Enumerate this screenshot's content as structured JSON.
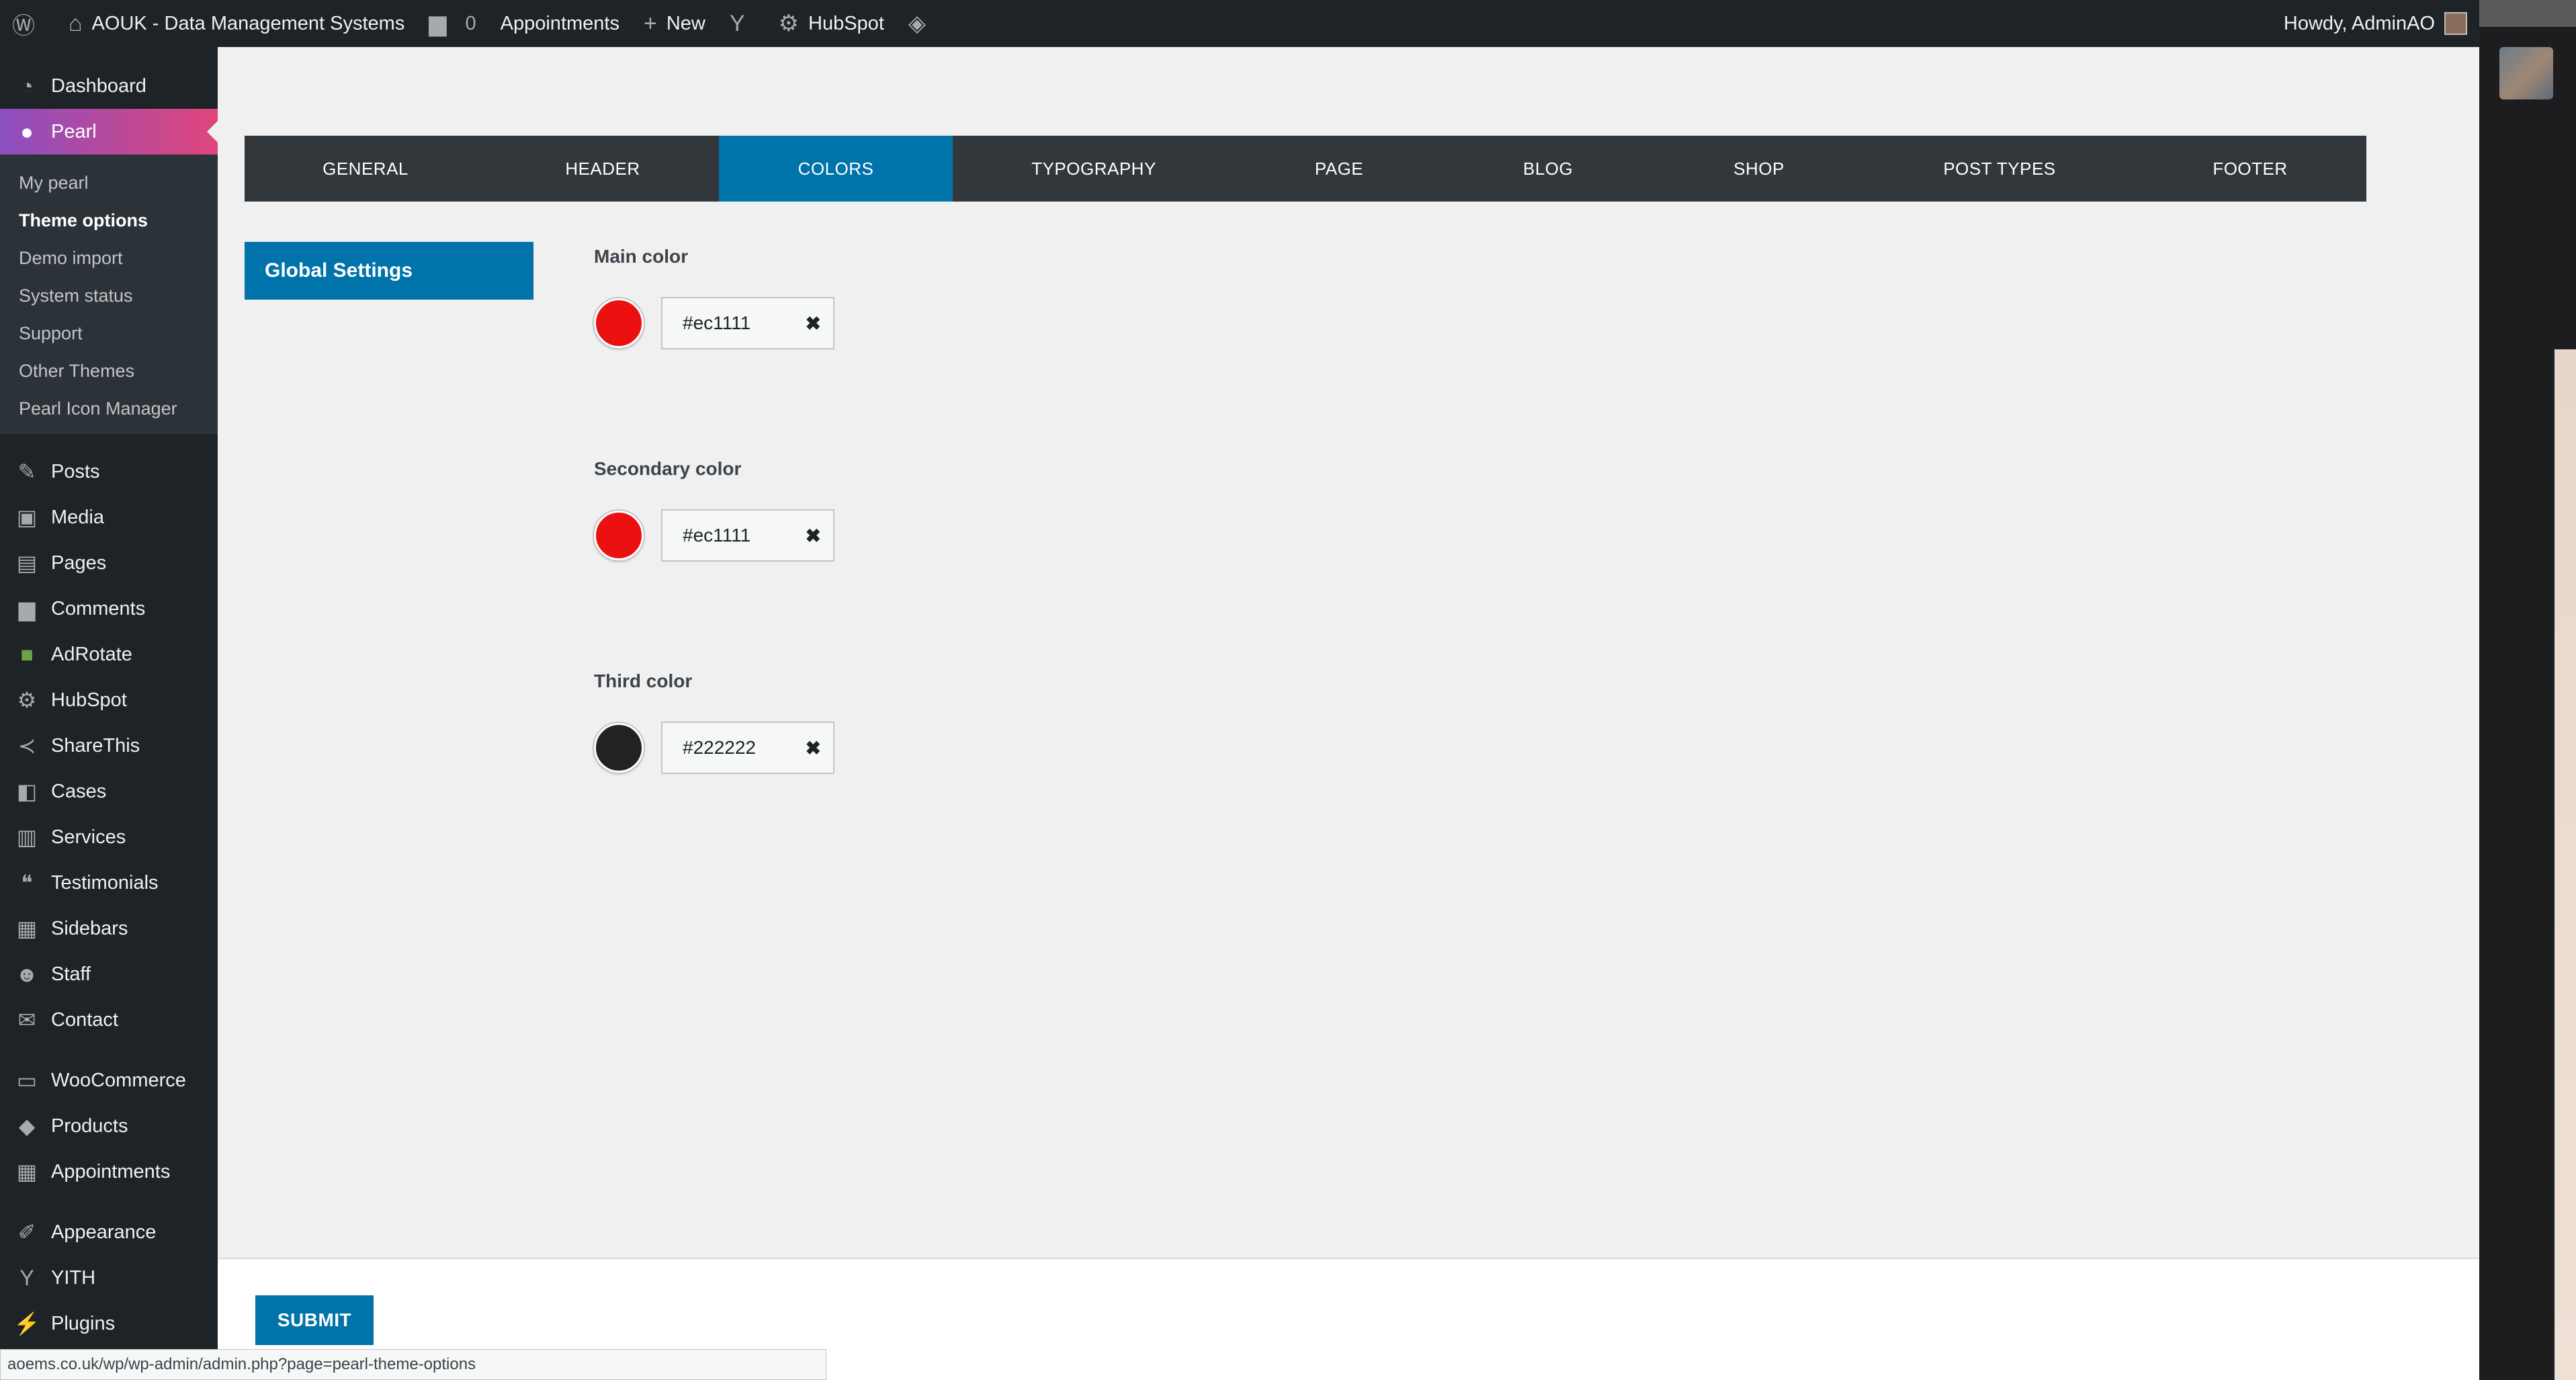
{
  "adminbar": {
    "site_name": "AOUK - Data Management Systems",
    "comments_count": "0",
    "appointments": "Appointments",
    "new": "New",
    "hubspot": "HubSpot",
    "howdy": "Howdy, AdminAO"
  },
  "sidebar": {
    "dashboard": "Dashboard",
    "pearl": "Pearl",
    "pearl_sub": [
      "My pearl",
      "Theme options",
      "Demo import",
      "System status",
      "Support",
      "Other Themes",
      "Pearl Icon Manager"
    ],
    "items_a": [
      "Posts",
      "Media",
      "Pages",
      "Comments",
      "AdRotate",
      "HubSpot",
      "ShareThis",
      "Cases",
      "Services",
      "Testimonials",
      "Sidebars",
      "Staff",
      "Contact"
    ],
    "items_b": [
      "WooCommerce",
      "Products",
      "Appointments"
    ],
    "items_c": [
      "Appearance",
      "YITH",
      "Plugins"
    ]
  },
  "tabs": [
    "GENERAL",
    "HEADER",
    "COLORS",
    "TYPOGRAPHY",
    "PAGE",
    "BLOG",
    "SHOP",
    "POST TYPES",
    "FOOTER"
  ],
  "active_tab": "COLORS",
  "side_tab": "Global Settings",
  "fields": [
    {
      "label": "Main color",
      "value": "#ec1111",
      "color": "#ec1111"
    },
    {
      "label": "Secondary color",
      "value": "#ec1111",
      "color": "#ec1111"
    },
    {
      "label": "Third color",
      "value": "#222222",
      "color": "#222222"
    }
  ],
  "submit_label": "SUBMIT",
  "status_url": "aoems.co.uk/wp/wp-admin/admin.php?page=pearl-theme-options",
  "colors": {
    "accent": "#0073aa",
    "admin_dark": "#1d2327",
    "tabbar": "#32373c"
  }
}
